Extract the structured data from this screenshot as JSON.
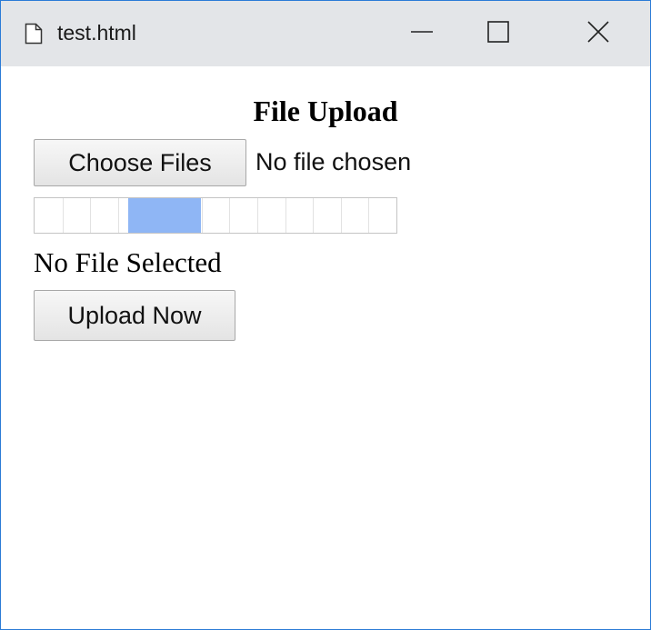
{
  "window": {
    "title": "test.html",
    "icons": {
      "document": "document-icon",
      "minimize": "minimize-icon",
      "maximize": "maximize-icon",
      "close": "close-icon"
    },
    "accent_color": "#2b7bd6"
  },
  "page": {
    "heading": "File Upload",
    "file_input": {
      "button_label": "Choose Files",
      "status_text": "No file chosen"
    },
    "progress": {
      "fill_color": "#8fb6f5",
      "segments": 13,
      "fill_start_fraction": 0.26,
      "fill_end_fraction": 0.46
    },
    "selection_status": "No File Selected",
    "upload_button_label": "Upload Now"
  }
}
